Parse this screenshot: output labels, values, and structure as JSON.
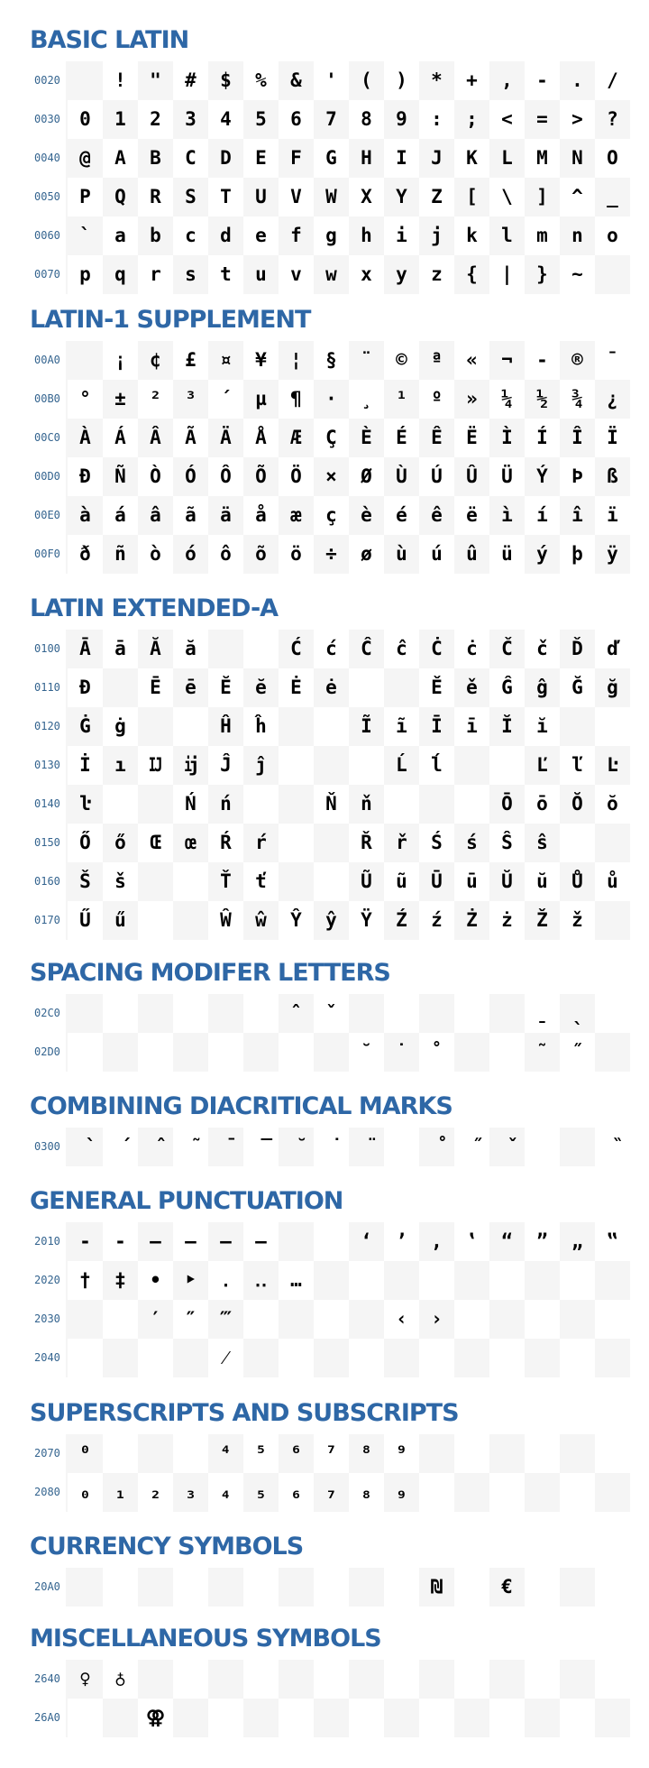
{
  "blocks": [
    {
      "title": "BASIC LATIN",
      "rows": [
        {
          "label": "0020",
          "cells": [
            " ",
            "!",
            "\"",
            "#",
            "$",
            "%",
            "&",
            "'",
            "(",
            ")",
            "*",
            "+",
            ",",
            "-",
            ".",
            "/"
          ]
        },
        {
          "label": "0030",
          "cells": [
            "0",
            "1",
            "2",
            "3",
            "4",
            "5",
            "6",
            "7",
            "8",
            "9",
            ":",
            ";",
            "<",
            "=",
            ">",
            "?"
          ]
        },
        {
          "label": "0040",
          "cells": [
            "@",
            "A",
            "B",
            "C",
            "D",
            "E",
            "F",
            "G",
            "H",
            "I",
            "J",
            "K",
            "L",
            "M",
            "N",
            "O"
          ]
        },
        {
          "label": "0050",
          "cells": [
            "P",
            "Q",
            "R",
            "S",
            "T",
            "U",
            "V",
            "W",
            "X",
            "Y",
            "Z",
            "[",
            "\\",
            "]",
            "^",
            "_"
          ]
        },
        {
          "label": "0060",
          "cells": [
            "`",
            "a",
            "b",
            "c",
            "d",
            "e",
            "f",
            "g",
            "h",
            "i",
            "j",
            "k",
            "l",
            "m",
            "n",
            "o"
          ]
        },
        {
          "label": "0070",
          "cells": [
            "p",
            "q",
            "r",
            "s",
            "t",
            "u",
            "v",
            "w",
            "x",
            "y",
            "z",
            "{",
            "|",
            "}",
            "~",
            ""
          ]
        }
      ]
    },
    {
      "title": "LATIN-1 SUPPLEMENT",
      "rows": [
        {
          "label": "00A0",
          "cells": [
            " ",
            "¡",
            "¢",
            "£",
            "¤",
            "¥",
            "¦",
            "§",
            "¨",
            "©",
            "ª",
            "«",
            "¬",
            "-",
            "®",
            "¯"
          ]
        },
        {
          "label": "00B0",
          "cells": [
            "°",
            "±",
            "²",
            "³",
            "´",
            "µ",
            "¶",
            "·",
            "¸",
            "¹",
            "º",
            "»",
            "¼",
            "½",
            "¾",
            "¿"
          ]
        },
        {
          "label": "00C0",
          "cells": [
            "À",
            "Á",
            "Â",
            "Ã",
            "Ä",
            "Å",
            "Æ",
            "Ç",
            "È",
            "É",
            "Ê",
            "Ë",
            "Ì",
            "Í",
            "Î",
            "Ï"
          ]
        },
        {
          "label": "00D0",
          "cells": [
            "Ð",
            "Ñ",
            "Ò",
            "Ó",
            "Ô",
            "Õ",
            "Ö",
            "×",
            "Ø",
            "Ù",
            "Ú",
            "Û",
            "Ü",
            "Ý",
            "Þ",
            "ß"
          ]
        },
        {
          "label": "00E0",
          "cells": [
            "à",
            "á",
            "â",
            "ã",
            "ä",
            "å",
            "æ",
            "ç",
            "è",
            "é",
            "ê",
            "ë",
            "ì",
            "í",
            "î",
            "ï"
          ]
        },
        {
          "label": "00F0",
          "cells": [
            "ð",
            "ñ",
            "ò",
            "ó",
            "ô",
            "õ",
            "ö",
            "÷",
            "ø",
            "ù",
            "ú",
            "û",
            "ü",
            "ý",
            "þ",
            "ÿ"
          ]
        }
      ]
    },
    {
      "title": "LATIN EXTENDED-A",
      "rows": [
        {
          "label": "0100",
          "cells": [
            "Ā",
            "ā",
            "Ă",
            "ă",
            "",
            "",
            "Ć",
            "ć",
            "Ĉ",
            "ĉ",
            "Ċ",
            "ċ",
            "Č",
            "č",
            "Ď",
            "ď"
          ]
        },
        {
          "label": "0110",
          "cells": [
            "Đ",
            "",
            "Ē",
            "ē",
            "Ĕ",
            "ĕ",
            "Ė",
            "ė",
            "",
            "",
            "Ě",
            "ě",
            "Ĝ",
            "ĝ",
            "Ğ",
            "ğ"
          ]
        },
        {
          "label": "0120",
          "cells": [
            "Ġ",
            "ġ",
            "",
            "",
            "Ĥ",
            "ĥ",
            "",
            "",
            "Ĩ",
            "ĩ",
            "Ī",
            "ī",
            "Ĭ",
            "ĭ",
            "",
            ""
          ]
        },
        {
          "label": "0130",
          "cells": [
            "İ",
            "ı",
            "Ĳ",
            "ĳ",
            "Ĵ",
            "ĵ",
            "",
            "",
            "",
            "Ĺ",
            "ĺ",
            "",
            "",
            "Ľ",
            "ľ",
            "Ŀ"
          ]
        },
        {
          "label": "0140",
          "cells": [
            "ŀ",
            "",
            "",
            "Ń",
            "ń",
            "",
            "",
            "Ň",
            "ň",
            "",
            "",
            "",
            "Ō",
            "ō",
            "Ŏ",
            "ŏ"
          ]
        },
        {
          "label": "0150",
          "cells": [
            "Ő",
            "ő",
            "Œ",
            "œ",
            "Ŕ",
            "ŕ",
            "",
            "",
            "Ř",
            "ř",
            "Ś",
            "ś",
            "Ŝ",
            "ŝ",
            "",
            ""
          ]
        },
        {
          "label": "0160",
          "cells": [
            "Š",
            "š",
            "",
            "",
            "Ť",
            "ť",
            "",
            "",
            "Ũ",
            "ũ",
            "Ū",
            "ū",
            "Ŭ",
            "ŭ",
            "Ů",
            "ů"
          ]
        },
        {
          "label": "0170",
          "cells": [
            "Ű",
            "ű",
            "",
            "",
            "Ŵ",
            "ŵ",
            "Ŷ",
            "ŷ",
            "Ÿ",
            "Ź",
            "ź",
            "Ż",
            "ż",
            "Ž",
            "ž",
            ""
          ]
        }
      ]
    },
    {
      "title": "SPACING MODIFER LETTERS",
      "rows": [
        {
          "label": "02C0",
          "cells": [
            "",
            "",
            "",
            "",
            "",
            "",
            "ˆ",
            "ˇ",
            "",
            "",
            "",
            "",
            "",
            "ˍ",
            "ˎ",
            ""
          ]
        },
        {
          "label": "02D0",
          "cells": [
            "",
            "",
            "",
            "",
            "",
            "",
            "",
            "",
            "˘",
            "˙",
            "˚",
            "",
            "",
            "˜",
            "˝",
            ""
          ]
        }
      ]
    },
    {
      "title": "COMBINING DIACRITICAL MARKS",
      "rows": [
        {
          "label": "0300",
          "cells": [
            "̀",
            "́",
            "̂",
            "̃",
            "̄",
            "̅",
            "̆",
            "̇",
            "̈",
            "",
            "̊",
            "̋",
            "̌",
            "",
            "",
            "̏"
          ]
        }
      ]
    },
    {
      "title": "GENERAL PUNCTUATION",
      "rows": [
        {
          "label": "2010",
          "cells": [
            "‐",
            "‑",
            "‒",
            "–",
            "—",
            "―",
            "",
            "",
            "‘",
            "’",
            "‚",
            "‛",
            "“",
            "”",
            "„",
            "‟"
          ]
        },
        {
          "label": "2020",
          "cells": [
            "†",
            "‡",
            "•",
            "‣",
            "․",
            "‥",
            "…",
            "",
            "",
            "",
            "",
            "",
            "",
            "",
            "",
            ""
          ]
        },
        {
          "label": "2030",
          "cells": [
            "",
            "",
            "′",
            "″",
            "‴",
            "",
            "",
            "",
            "",
            "‹",
            "›",
            "",
            "",
            "",
            "",
            ""
          ]
        },
        {
          "label": "2040",
          "cells": [
            "",
            "",
            "",
            "",
            "⁄",
            "",
            "",
            "",
            "",
            "",
            "",
            "",
            "",
            "",
            "",
            ""
          ]
        }
      ]
    },
    {
      "title": "SUPERSCRIPTS AND SUBSCRIPTS",
      "rows": [
        {
          "label": "2070",
          "cells": [
            "⁰",
            "",
            "",
            "",
            "⁴",
            "⁵",
            "⁶",
            "⁷",
            "⁸",
            "⁹",
            "",
            "",
            "",
            "",
            "",
            ""
          ]
        },
        {
          "label": "2080",
          "cells": [
            "₀",
            "₁",
            "₂",
            "₃",
            "₄",
            "₅",
            "₆",
            "₇",
            "₈",
            "₉",
            "",
            "",
            "",
            "",
            "",
            ""
          ]
        }
      ]
    },
    {
      "title": "CURRENCY SYMBOLS",
      "rows": [
        {
          "label": "20A0",
          "cells": [
            "",
            "",
            "",
            "",
            "",
            "",
            "",
            "",
            "",
            "",
            "₪",
            "",
            "€",
            "",
            "",
            ""
          ]
        }
      ]
    },
    {
      "title": "MISCELLANEOUS SYMBOLS",
      "rows": [
        {
          "label": "2640",
          "cells": [
            "♀",
            "♁",
            "",
            "",
            "",
            "",
            "",
            "",
            "",
            "",
            "",
            "",
            "",
            "",
            "",
            ""
          ]
        },
        {
          "label": "26A0",
          "cells": [
            "",
            "",
            "⚢",
            "",
            "",
            "",
            "",
            "",
            "",
            "",
            "",
            "",
            "",
            "",
            "",
            ""
          ]
        }
      ]
    }
  ]
}
